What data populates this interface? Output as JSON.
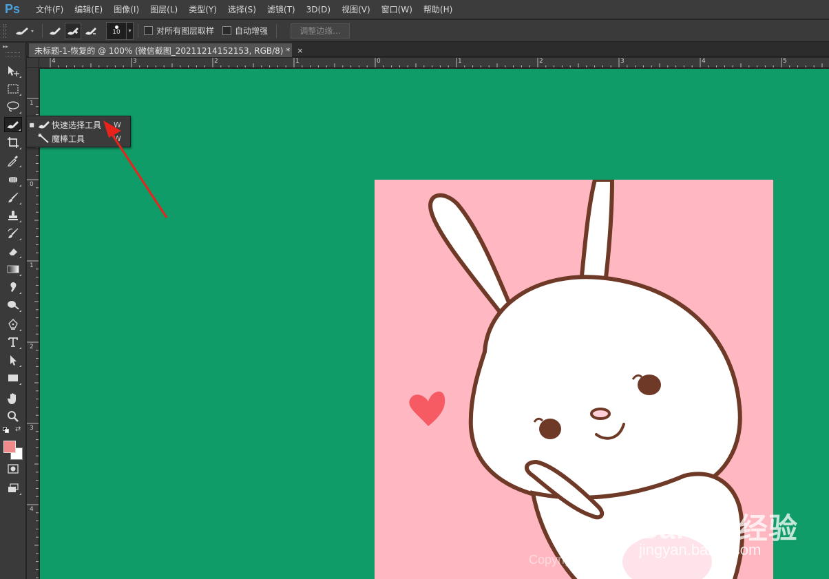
{
  "app": {
    "logo": "Ps"
  },
  "menu": [
    {
      "label": "文件(F)"
    },
    {
      "label": "编辑(E)"
    },
    {
      "label": "图像(I)"
    },
    {
      "label": "图层(L)"
    },
    {
      "label": "类型(Y)"
    },
    {
      "label": "选择(S)"
    },
    {
      "label": "滤镜(T)"
    },
    {
      "label": "3D(D)"
    },
    {
      "label": "视图(V)"
    },
    {
      "label": "窗口(W)"
    },
    {
      "label": "帮助(H)"
    }
  ],
  "options": {
    "brush_size": "10",
    "sample_all_layers_label": "对所有图层取样",
    "auto_enhance_label": "自动增强",
    "refine_edge_label": "调整边缘..."
  },
  "document": {
    "tab_title": "未标题-1-恢复的 @ 100% (微信截图_20211214152153, RGB/8) *",
    "tab_close": "×"
  },
  "rulers": {
    "horizontal": [
      "4",
      "3",
      "2",
      "1",
      "0",
      "1",
      "2",
      "3",
      "4",
      "5"
    ],
    "vertical": [
      "1",
      "0",
      "1",
      "2",
      "3",
      "4"
    ]
  },
  "flyout": {
    "items": [
      {
        "label": "快速选择工具",
        "shortcut": "W",
        "selected": true,
        "bullet": "■"
      },
      {
        "label": "魔棒工具",
        "shortcut": "W",
        "selected": false,
        "bullet": ""
      }
    ]
  },
  "colors": {
    "foreground": "#f08a8a",
    "background": "#ffffff",
    "canvas": "#0f9c68",
    "image_bg": "#ffb7c1",
    "arrow": "#e8231c"
  },
  "watermark": {
    "brand": "Bai du 经验",
    "sub": "jingyan.baidu.com",
    "copyright": "Copyright"
  },
  "tools": [
    {
      "name": "move-tool-icon"
    },
    {
      "name": "marquee-tool-icon"
    },
    {
      "name": "lasso-tool-icon"
    },
    {
      "name": "quick-selection-tool-icon"
    },
    {
      "name": "crop-tool-icon"
    },
    {
      "name": "eyedropper-tool-icon"
    },
    {
      "name": "healing-brush-tool-icon"
    },
    {
      "name": "brush-tool-icon"
    },
    {
      "name": "clone-stamp-tool-icon"
    },
    {
      "name": "history-brush-tool-icon"
    },
    {
      "name": "eraser-tool-icon"
    },
    {
      "name": "gradient-tool-icon"
    },
    {
      "name": "blur-tool-icon"
    },
    {
      "name": "dodge-tool-icon"
    },
    {
      "name": "pen-tool-icon"
    },
    {
      "name": "type-tool-icon"
    },
    {
      "name": "path-selection-tool-icon"
    },
    {
      "name": "rectangle-tool-icon"
    },
    {
      "name": "hand-tool-icon"
    },
    {
      "name": "zoom-tool-icon"
    }
  ]
}
